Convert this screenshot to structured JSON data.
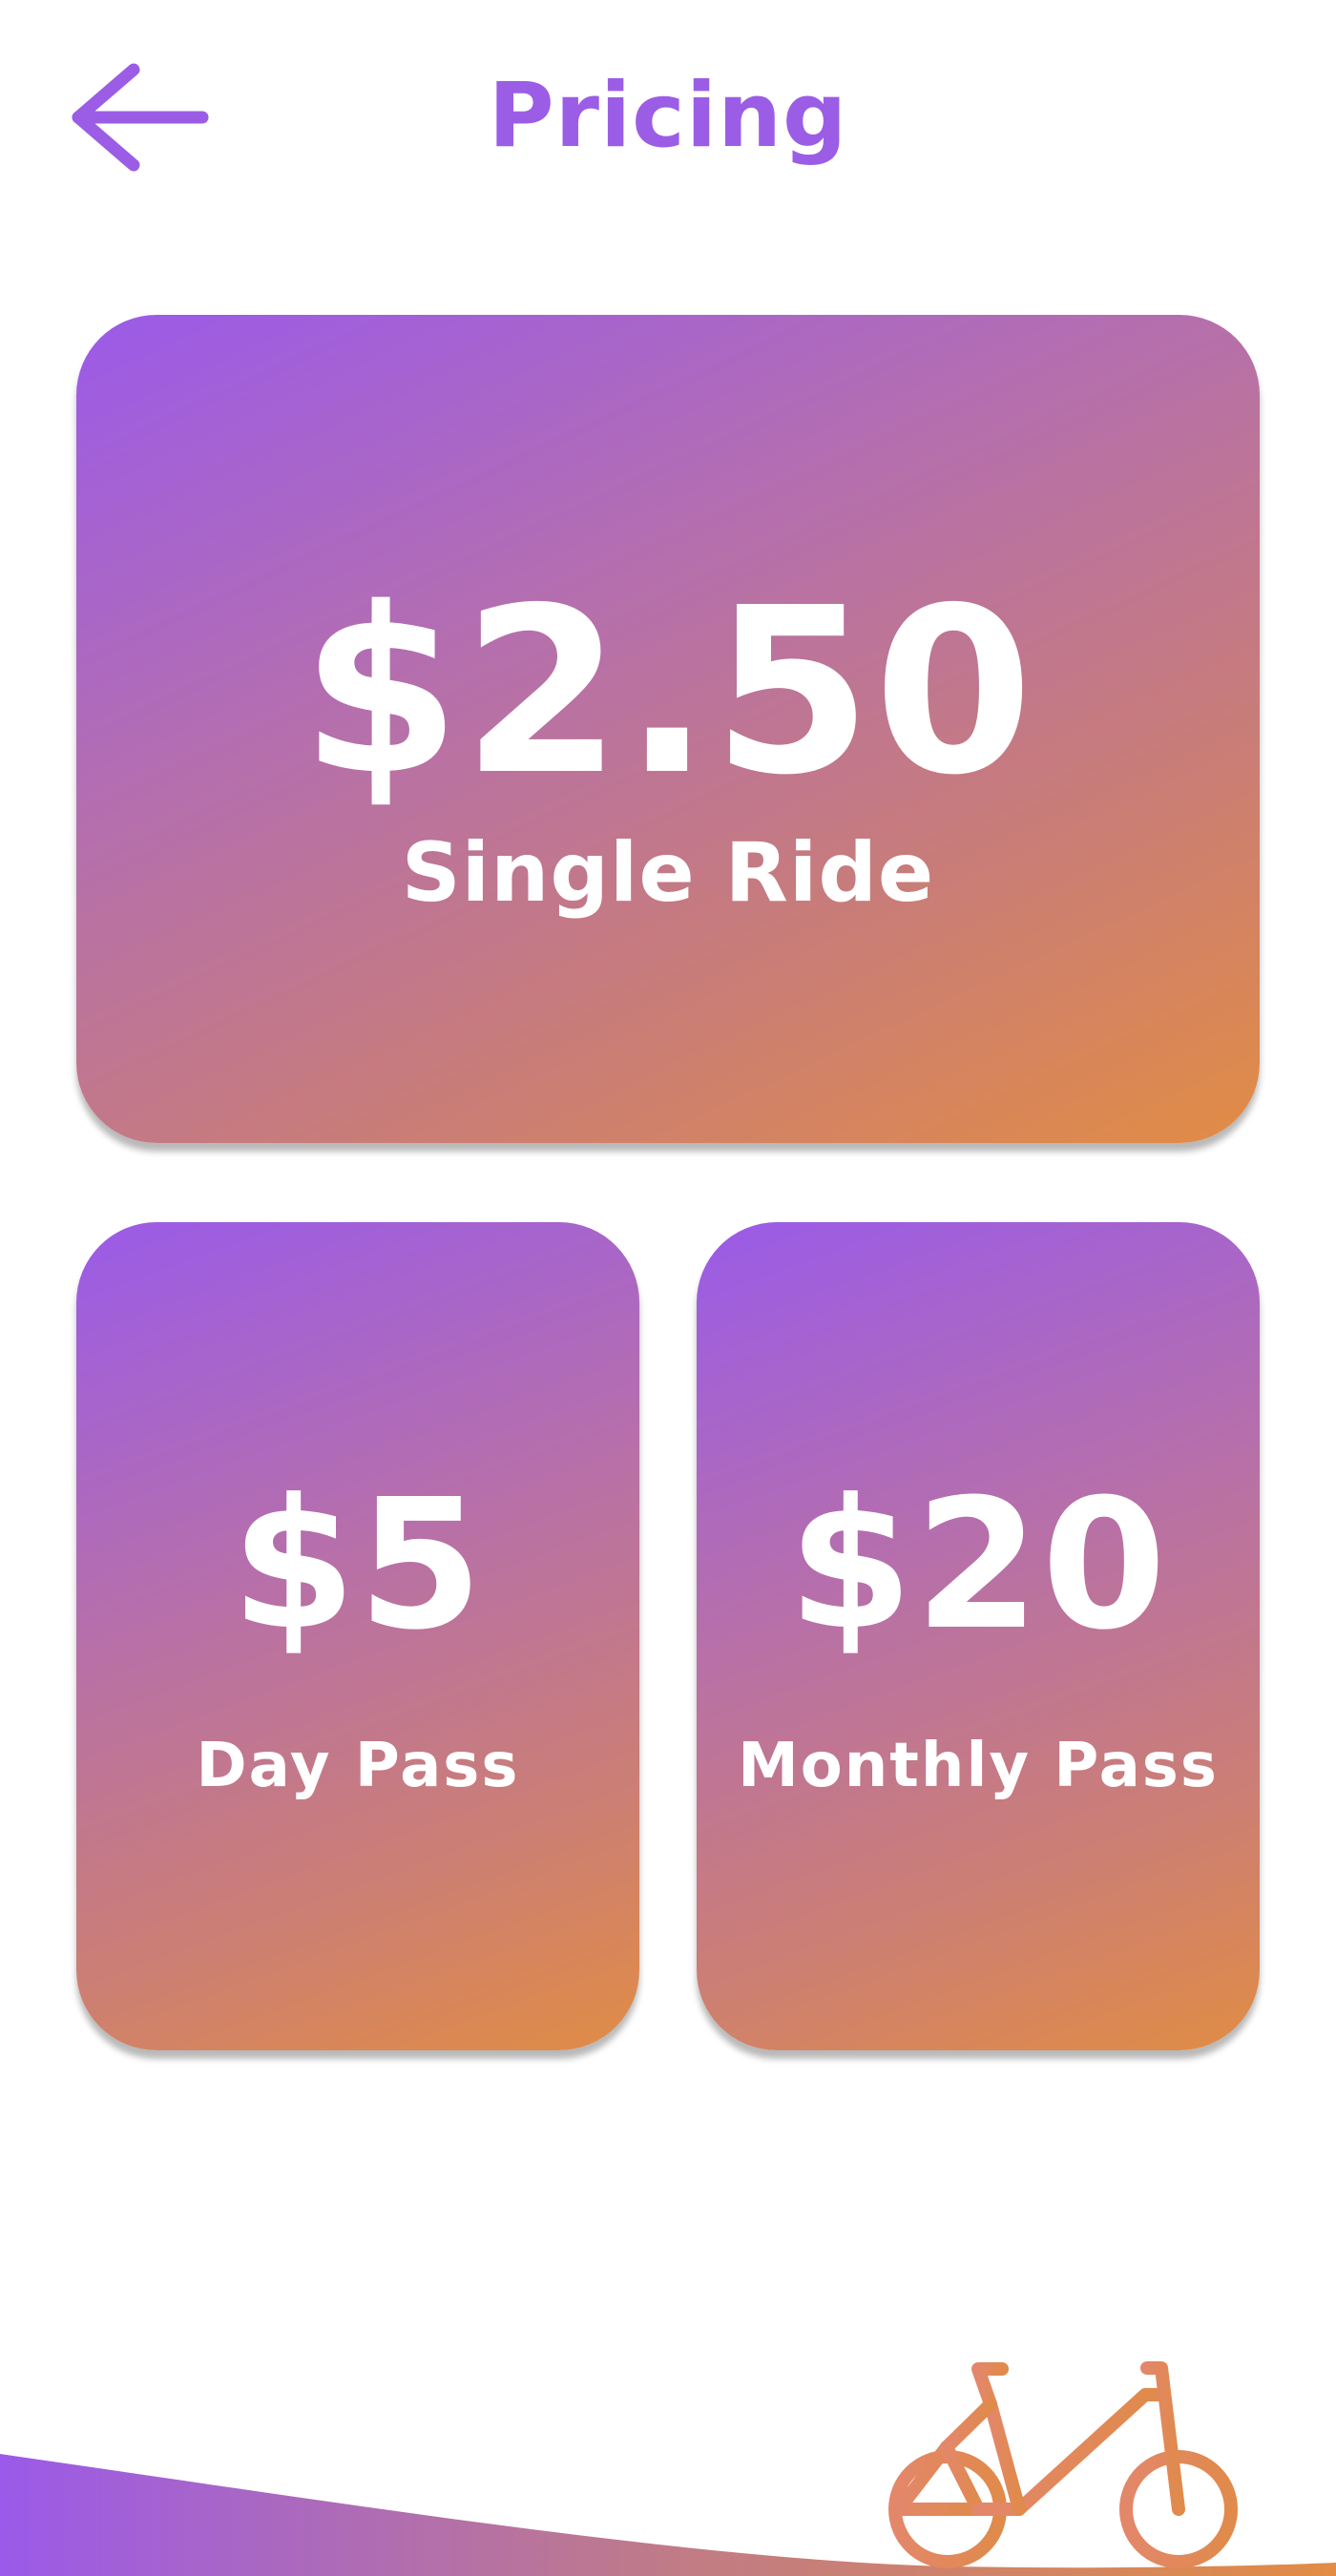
{
  "header": {
    "title": "Pricing",
    "back_icon": "arrow-left-icon"
  },
  "colors": {
    "accent": "#9b5de5",
    "gradient_start": "#9b5ae9",
    "gradient_end": "#e28c45",
    "text_on_card": "#ffffff",
    "background": "#ffffff"
  },
  "pricing": {
    "single": {
      "price": "$2.50",
      "label": "Single Ride"
    },
    "day": {
      "price": "$5",
      "label": "Day Pass"
    },
    "monthly": {
      "price": "$20",
      "label": "Monthly Pass"
    }
  },
  "footer": {
    "icon": "bicycle-icon"
  }
}
